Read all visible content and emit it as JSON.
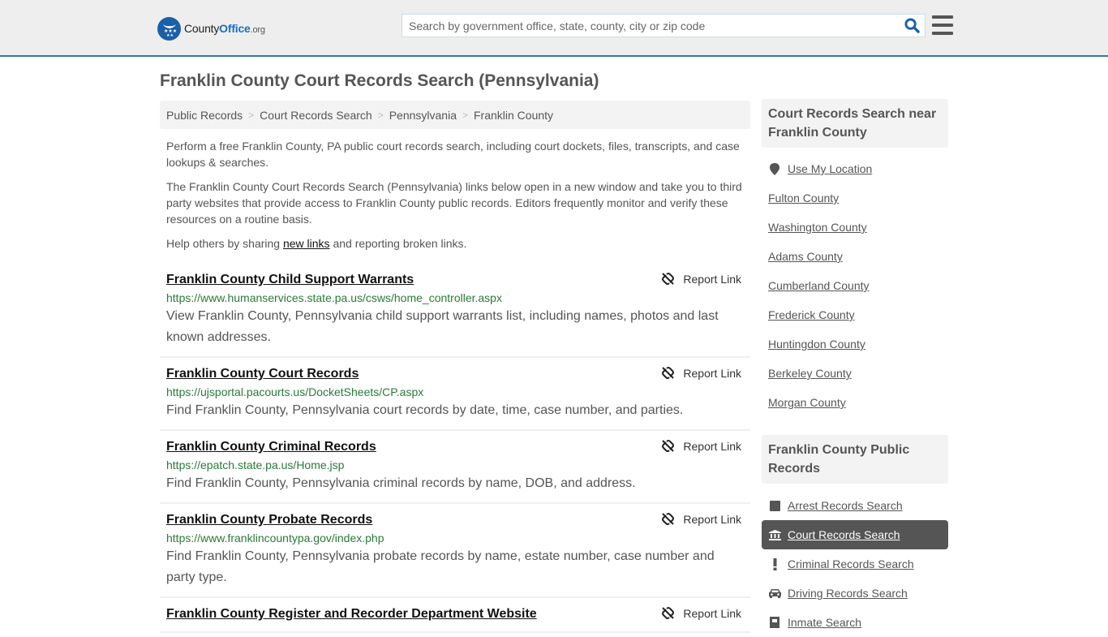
{
  "header": {
    "logo": {
      "county": "County",
      "office": "Office",
      "org": ".org"
    },
    "search": {
      "placeholder": "Search by government office, state, county, city or zip code",
      "value": ""
    },
    "search_icon": "search-icon",
    "menu_icon": "hamburger-menu-icon"
  },
  "page": {
    "title": "Franklin County Court Records Search (Pennsylvania)"
  },
  "breadcrumb": [
    {
      "label": "Public Records"
    },
    {
      "label": "Court Records Search"
    },
    {
      "label": "Pennsylvania"
    },
    {
      "label": "Franklin County"
    }
  ],
  "intro": {
    "p1": "Perform a free Franklin County, PA public court records search, including court dockets, files, transcripts, and case lookups & searches.",
    "p2": "The Franklin County Court Records Search (Pennsylvania) links below open in a new window and take you to third party websites that provide access to Franklin County public records. Editors frequently monitor and verify these resources on a routine basis.",
    "p3_before": "Help others by sharing ",
    "p3_link": "new links",
    "p3_after": " and reporting broken links."
  },
  "report_label": "Report Link",
  "links": [
    {
      "title": "Franklin County Child Support Warrants",
      "url": "https://www.humanservices.state.pa.us/csws/home_controller.aspx",
      "desc": "View Franklin County, Pennsylvania child support warrants list, including names, photos and last known addresses."
    },
    {
      "title": "Franklin County Court Records",
      "url": "https://ujsportal.pacourts.us/DocketSheets/CP.aspx",
      "desc": "Find Franklin County, Pennsylvania court records by date, time, case number, and parties."
    },
    {
      "title": "Franklin County Criminal Records",
      "url": "https://epatch.state.pa.us/Home.jsp",
      "desc": "Find Franklin County, Pennsylvania criminal records by name, DOB, and address."
    },
    {
      "title": "Franklin County Probate Records",
      "url": "https://www.franklincountypa.gov/index.php",
      "desc": "Find Franklin County, Pennsylvania probate records by name, estate number, case number and party type."
    },
    {
      "title": "Franklin County Register and Recorder Department Website",
      "url": "",
      "desc": ""
    }
  ],
  "sidebar": {
    "nearby": {
      "heading": "Court Records Search near Franklin County",
      "use_location": "Use My Location",
      "counties": [
        "Fulton County",
        "Washington County",
        "Adams County",
        "Cumberland County",
        "Frederick County",
        "Huntingdon County",
        "Berkeley County",
        "Morgan County"
      ]
    },
    "public_records": {
      "heading": "Franklin County Public Records",
      "items": [
        {
          "label": "Arrest Records Search",
          "icon": "square-icon",
          "active": false
        },
        {
          "label": "Court Records Search",
          "icon": "courthouse-icon",
          "active": true
        },
        {
          "label": "Criminal Records Search",
          "icon": "exclamation-icon",
          "active": false
        },
        {
          "label": "Driving Records Search",
          "icon": "car-icon",
          "active": false
        },
        {
          "label": "Inmate Search",
          "icon": "jail-icon",
          "active": false
        }
      ]
    }
  }
}
